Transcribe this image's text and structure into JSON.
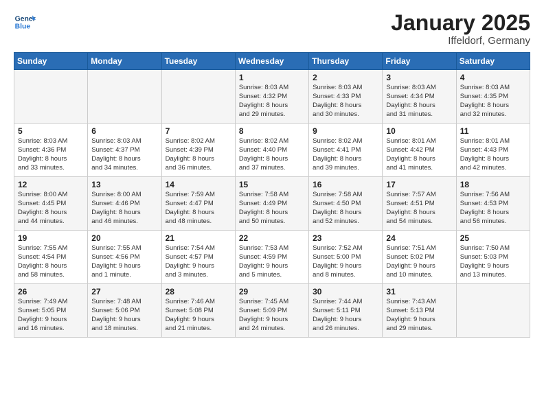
{
  "header": {
    "logo_line1": "General",
    "logo_line2": "Blue",
    "month": "January 2025",
    "location": "Iffeldorf, Germany"
  },
  "weekdays": [
    "Sunday",
    "Monday",
    "Tuesday",
    "Wednesday",
    "Thursday",
    "Friday",
    "Saturday"
  ],
  "weeks": [
    [
      {
        "day": "",
        "info": ""
      },
      {
        "day": "",
        "info": ""
      },
      {
        "day": "",
        "info": ""
      },
      {
        "day": "1",
        "info": "Sunrise: 8:03 AM\nSunset: 4:32 PM\nDaylight: 8 hours\nand 29 minutes."
      },
      {
        "day": "2",
        "info": "Sunrise: 8:03 AM\nSunset: 4:33 PM\nDaylight: 8 hours\nand 30 minutes."
      },
      {
        "day": "3",
        "info": "Sunrise: 8:03 AM\nSunset: 4:34 PM\nDaylight: 8 hours\nand 31 minutes."
      },
      {
        "day": "4",
        "info": "Sunrise: 8:03 AM\nSunset: 4:35 PM\nDaylight: 8 hours\nand 32 minutes."
      }
    ],
    [
      {
        "day": "5",
        "info": "Sunrise: 8:03 AM\nSunset: 4:36 PM\nDaylight: 8 hours\nand 33 minutes."
      },
      {
        "day": "6",
        "info": "Sunrise: 8:03 AM\nSunset: 4:37 PM\nDaylight: 8 hours\nand 34 minutes."
      },
      {
        "day": "7",
        "info": "Sunrise: 8:02 AM\nSunset: 4:39 PM\nDaylight: 8 hours\nand 36 minutes."
      },
      {
        "day": "8",
        "info": "Sunrise: 8:02 AM\nSunset: 4:40 PM\nDaylight: 8 hours\nand 37 minutes."
      },
      {
        "day": "9",
        "info": "Sunrise: 8:02 AM\nSunset: 4:41 PM\nDaylight: 8 hours\nand 39 minutes."
      },
      {
        "day": "10",
        "info": "Sunrise: 8:01 AM\nSunset: 4:42 PM\nDaylight: 8 hours\nand 41 minutes."
      },
      {
        "day": "11",
        "info": "Sunrise: 8:01 AM\nSunset: 4:43 PM\nDaylight: 8 hours\nand 42 minutes."
      }
    ],
    [
      {
        "day": "12",
        "info": "Sunrise: 8:00 AM\nSunset: 4:45 PM\nDaylight: 8 hours\nand 44 minutes."
      },
      {
        "day": "13",
        "info": "Sunrise: 8:00 AM\nSunset: 4:46 PM\nDaylight: 8 hours\nand 46 minutes."
      },
      {
        "day": "14",
        "info": "Sunrise: 7:59 AM\nSunset: 4:47 PM\nDaylight: 8 hours\nand 48 minutes."
      },
      {
        "day": "15",
        "info": "Sunrise: 7:58 AM\nSunset: 4:49 PM\nDaylight: 8 hours\nand 50 minutes."
      },
      {
        "day": "16",
        "info": "Sunrise: 7:58 AM\nSunset: 4:50 PM\nDaylight: 8 hours\nand 52 minutes."
      },
      {
        "day": "17",
        "info": "Sunrise: 7:57 AM\nSunset: 4:51 PM\nDaylight: 8 hours\nand 54 minutes."
      },
      {
        "day": "18",
        "info": "Sunrise: 7:56 AM\nSunset: 4:53 PM\nDaylight: 8 hours\nand 56 minutes."
      }
    ],
    [
      {
        "day": "19",
        "info": "Sunrise: 7:55 AM\nSunset: 4:54 PM\nDaylight: 8 hours\nand 58 minutes."
      },
      {
        "day": "20",
        "info": "Sunrise: 7:55 AM\nSunset: 4:56 PM\nDaylight: 9 hours\nand 1 minute."
      },
      {
        "day": "21",
        "info": "Sunrise: 7:54 AM\nSunset: 4:57 PM\nDaylight: 9 hours\nand 3 minutes."
      },
      {
        "day": "22",
        "info": "Sunrise: 7:53 AM\nSunset: 4:59 PM\nDaylight: 9 hours\nand 5 minutes."
      },
      {
        "day": "23",
        "info": "Sunrise: 7:52 AM\nSunset: 5:00 PM\nDaylight: 9 hours\nand 8 minutes."
      },
      {
        "day": "24",
        "info": "Sunrise: 7:51 AM\nSunset: 5:02 PM\nDaylight: 9 hours\nand 10 minutes."
      },
      {
        "day": "25",
        "info": "Sunrise: 7:50 AM\nSunset: 5:03 PM\nDaylight: 9 hours\nand 13 minutes."
      }
    ],
    [
      {
        "day": "26",
        "info": "Sunrise: 7:49 AM\nSunset: 5:05 PM\nDaylight: 9 hours\nand 16 minutes."
      },
      {
        "day": "27",
        "info": "Sunrise: 7:48 AM\nSunset: 5:06 PM\nDaylight: 9 hours\nand 18 minutes."
      },
      {
        "day": "28",
        "info": "Sunrise: 7:46 AM\nSunset: 5:08 PM\nDaylight: 9 hours\nand 21 minutes."
      },
      {
        "day": "29",
        "info": "Sunrise: 7:45 AM\nSunset: 5:09 PM\nDaylight: 9 hours\nand 24 minutes."
      },
      {
        "day": "30",
        "info": "Sunrise: 7:44 AM\nSunset: 5:11 PM\nDaylight: 9 hours\nand 26 minutes."
      },
      {
        "day": "31",
        "info": "Sunrise: 7:43 AM\nSunset: 5:13 PM\nDaylight: 9 hours\nand 29 minutes."
      },
      {
        "day": "",
        "info": ""
      }
    ]
  ]
}
